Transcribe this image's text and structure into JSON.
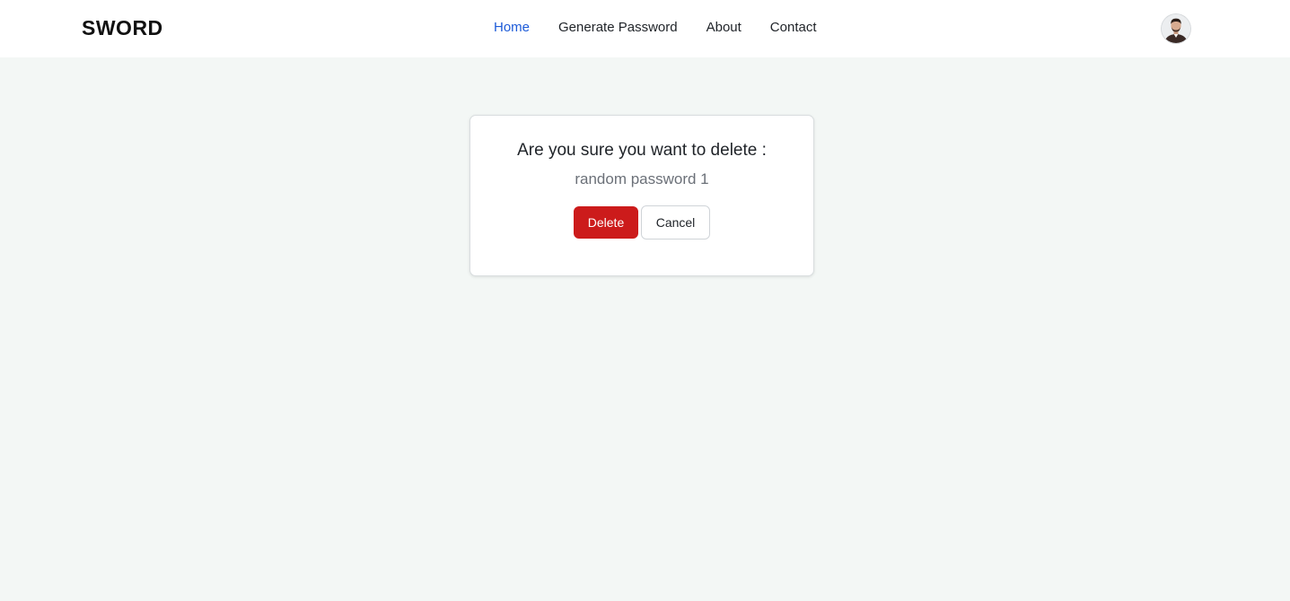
{
  "brand": "SWORD",
  "nav": {
    "items": [
      {
        "label": "Home",
        "active": true
      },
      {
        "label": "Generate Password",
        "active": false
      },
      {
        "label": "About",
        "active": false
      },
      {
        "label": "Contact",
        "active": false
      }
    ]
  },
  "user": {
    "avatar_icon": "user-avatar-photo"
  },
  "dialog": {
    "title": "Are you sure you want to delete :",
    "item_name": "random password 1",
    "delete_label": "Delete",
    "cancel_label": "Cancel"
  },
  "colors": {
    "accent": "#1d5bd8",
    "danger": "#cc1b1b",
    "background": "#f3f7f5"
  }
}
